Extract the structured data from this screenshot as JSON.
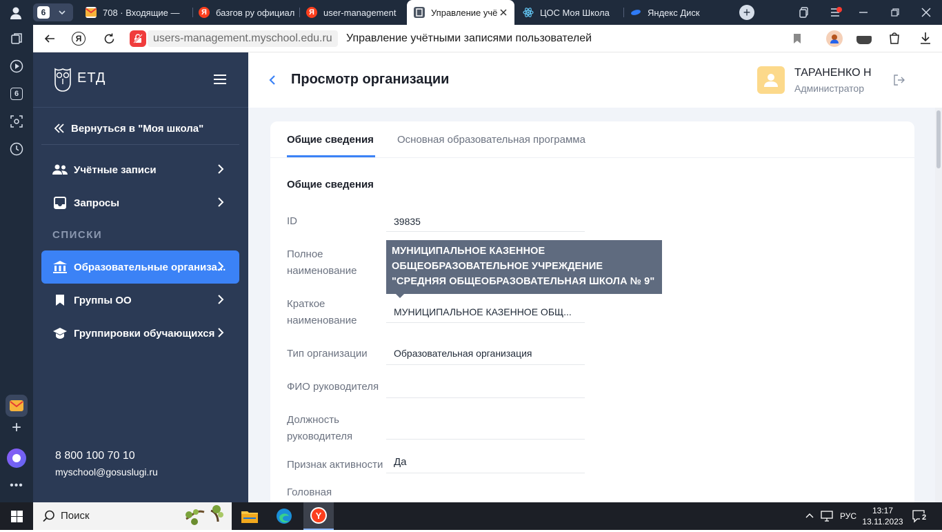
{
  "browser": {
    "tab_count": "6",
    "tabs": [
      {
        "title": "708 · Входящие —"
      },
      {
        "title": "базгов ру официал"
      },
      {
        "title": "user-management"
      },
      {
        "title": "Управление учё"
      },
      {
        "title": "ЦОС Моя Школа"
      },
      {
        "title": "Яндекс Диск"
      }
    ],
    "yandex_logo": "Я",
    "url": "users-management.myschool.edu.ru",
    "page_title": "Управление учётными записями пользователей",
    "rail_badge": "6"
  },
  "sidebar": {
    "logo_text": "ЕТД",
    "back_link": "Вернуться в \"Моя школа\"",
    "items": [
      {
        "label": "Учётные записи",
        "icon": "users-icon"
      },
      {
        "label": "Запросы",
        "icon": "inbox-icon"
      }
    ],
    "section_title": "СПИСКИ",
    "list_items": [
      {
        "label": "Образовательные организа...",
        "icon": "institution-icon"
      },
      {
        "label": "Группы ОО",
        "icon": "bookmark-icon"
      },
      {
        "label": "Группировки обучающихся",
        "icon": "graduation-cap-icon"
      }
    ],
    "phone": "8 800 100 70 10",
    "email": "myschool@gosuslugi.ru"
  },
  "header": {
    "title": "Просмотр организации",
    "user_name": "ТАРАНЕНКО Н",
    "user_role": "Администратор"
  },
  "tabs": [
    {
      "label": "Общие сведения"
    },
    {
      "label": "Основная образовательная программа"
    }
  ],
  "section": {
    "title": "Общие сведения",
    "fields": [
      {
        "label": "ID",
        "value": "39835"
      },
      {
        "label": "Полное наименование",
        "value": ""
      },
      {
        "label": "Краткое наименование",
        "value": "МУНИЦИПАЛЬНОЕ КАЗЕННОЕ ОБЩ..."
      },
      {
        "label": "Тип организации",
        "value": "Образовательная организация"
      },
      {
        "label": "ФИО руководителя",
        "value": ""
      },
      {
        "label": "Должность руководителя",
        "value": ""
      },
      {
        "label": "Признак активности",
        "value": "Да"
      },
      {
        "label": "Головная",
        "value": ""
      }
    ],
    "tooltip": "МУНИЦИПАЛЬНОЕ КАЗЕННОЕ ОБЩЕОБРАЗОВАТЕЛЬНОЕ УЧРЕЖДЕНИЕ \"СРЕДНЯЯ ОБЩЕОБРАЗОВАТЕЛЬНАЯ ШКОЛА № 9\""
  },
  "taskbar": {
    "search_placeholder": "Поиск",
    "language": "РУС",
    "time": "13:17",
    "date": "13.11.2023",
    "notification_count": "2"
  },
  "colors": {
    "sidebar_bg": "#2b3a55",
    "accent": "#3b82f6",
    "tooltip_bg": "#5f6b7f"
  }
}
